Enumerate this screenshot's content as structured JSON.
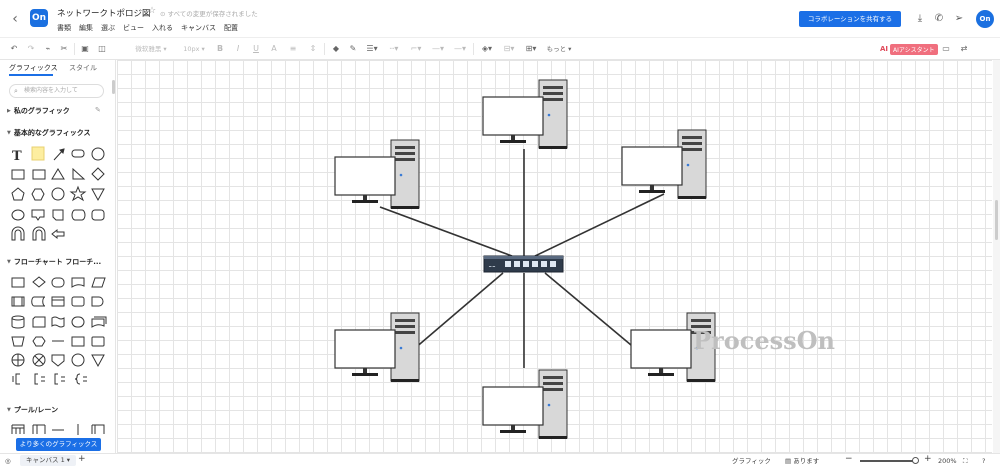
{
  "header": {
    "logo": "On",
    "title": "ネットワークトポロジ図",
    "saved_status": "すべての変更が保存されました",
    "menus": [
      "書類",
      "編集",
      "選ぶ",
      "ビュー",
      "入れる",
      "キャンバス",
      "配置"
    ],
    "share_button": "コラボレーションを共有する",
    "avatar": "On"
  },
  "toolbar": {
    "font_name": "微软雅黑",
    "font_size": "10px",
    "more": "もっと",
    "ai_mark": "AI",
    "ai_label": "AIアシスタント"
  },
  "sidebar": {
    "tabs": [
      "グラフィックス",
      "スタイル"
    ],
    "search_placeholder": "検索内容を入力して",
    "sections": [
      "私のグラフィック",
      "基本的なグラフィックス",
      "フローチャート フローチ...",
      "プール/レーン"
    ],
    "more_button": "より多くのグラフィックス"
  },
  "canvas": {
    "watermark": "ProcessOn"
  },
  "footer": {
    "page_tab": "キャンバス 1",
    "graphics_label": "グラフィック",
    "presence_label": "あります",
    "zoom": "200%"
  },
  "colors": {
    "accent": "#1b6fe6",
    "ai": "#f06f7e",
    "grid": "#e4e4e4",
    "device_dark": "#2f3b4b"
  }
}
